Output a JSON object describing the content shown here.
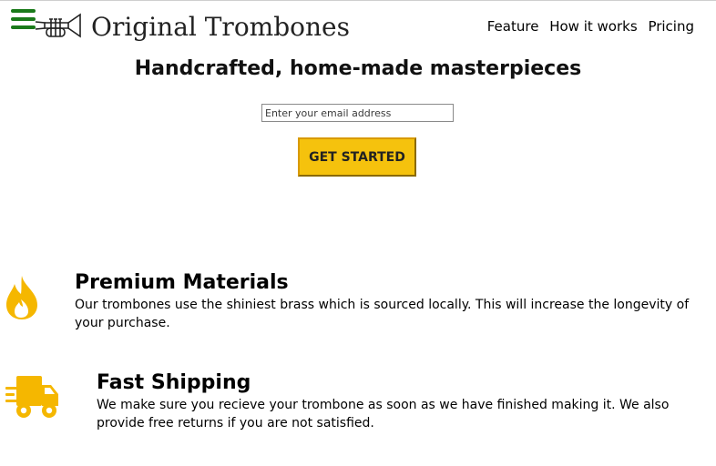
{
  "header": {
    "brand": "Original Trombones",
    "menu_icon": "hamburger-menu-icon",
    "logo_icon": "trumpet-icon",
    "nav": [
      {
        "label": "Feature"
      },
      {
        "label": "How it works"
      },
      {
        "label": "Pricing"
      }
    ]
  },
  "hero": {
    "headline": "Handcrafted, home-made masterpieces",
    "email_placeholder": "Enter your email address",
    "cta_label": "GET STARTED"
  },
  "features": [
    {
      "icon": "fire-icon",
      "title": "Premium Materials",
      "text": "Our trombones use the shiniest brass which is sourced locally. This will increase the longevity of your purchase."
    },
    {
      "icon": "truck-icon",
      "title": "Fast Shipping",
      "text": "We make sure you recieve your trombone as soon as we have finished making it. We also provide free returns if you are not satisfied."
    }
  ],
  "colors": {
    "accent_yellow": "#f5c20d",
    "menu_green": "#1a7a1a",
    "icon_orange": "#f5b700"
  }
}
